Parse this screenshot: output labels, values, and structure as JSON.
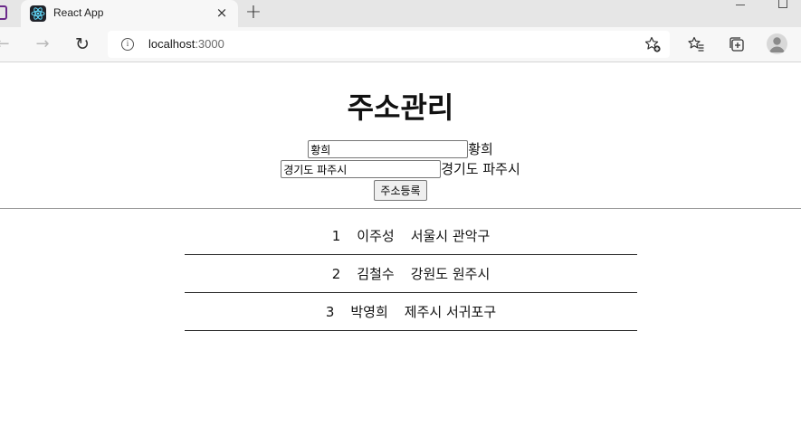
{
  "browser": {
    "tab_title": "React App",
    "tab_close": "×",
    "new_tab": "+",
    "url_host": "localhost",
    "url_port": ":3000"
  },
  "app": {
    "title": "주소관리",
    "name_input_value": "황희",
    "name_echo": "황희",
    "address_input_value": "경기도 파주시",
    "address_echo": "경기도 파주시",
    "submit_label": "주소등록"
  },
  "addresses": [
    {
      "id": "1",
      "name": "이주성",
      "address": "서울시 관악구"
    },
    {
      "id": "2",
      "name": "김철수",
      "address": "강원도 원주시"
    },
    {
      "id": "3",
      "name": "박영희",
      "address": "제주시 서귀포구"
    }
  ]
}
